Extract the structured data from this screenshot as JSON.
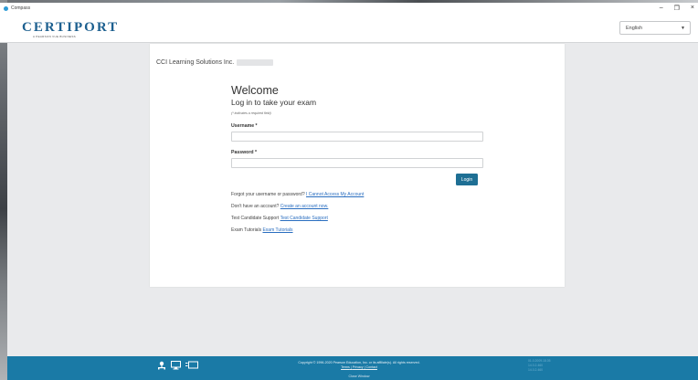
{
  "window": {
    "title": "Compass",
    "minimize": "–",
    "restore": "❐",
    "close": "×"
  },
  "header": {
    "logo_text": "CERTIPORT",
    "logo_subtext": "A PEARSON VUE BUSINESS",
    "language_value": "English"
  },
  "card": {
    "org_name": "CCI Learning Solutions Inc.",
    "welcome": "Welcome",
    "subtitle": "Log in to take your exam",
    "required_note": "(* indicates a required field)",
    "username_label": "Username *",
    "password_label": "Password *",
    "login_label": "Login",
    "links": [
      {
        "prefix": "Forgot your username or password?",
        "link": "I Cannot Access My Account"
      },
      {
        "prefix": "Don't have an account?",
        "link": "Create an account now."
      },
      {
        "prefix": "Test Candidate Support",
        "link": "Test Candidate Support"
      },
      {
        "prefix": "Exam Tutorials",
        "link": "Exam Tutorials"
      }
    ]
  },
  "footer": {
    "copyright": "Copyright © 1996-2020 Pearson Education, Inc. or its affiliate(s). All rights reserved.",
    "terms": "Terms",
    "privacy": "Privacy",
    "contact": "Contact",
    "close_window": "Close Window",
    "version_lines": [
      "01.0.2009.18.05",
      "14.0.2.460",
      "14.0.2.460"
    ]
  },
  "icons": {
    "network": "network-icon",
    "monitor": "monitor-icon",
    "display": "display-icon"
  },
  "colors": {
    "brand": "#1c5f8f",
    "footer": "#1a7aa6",
    "button": "#1e6f94",
    "link": "#2a6ec0"
  }
}
